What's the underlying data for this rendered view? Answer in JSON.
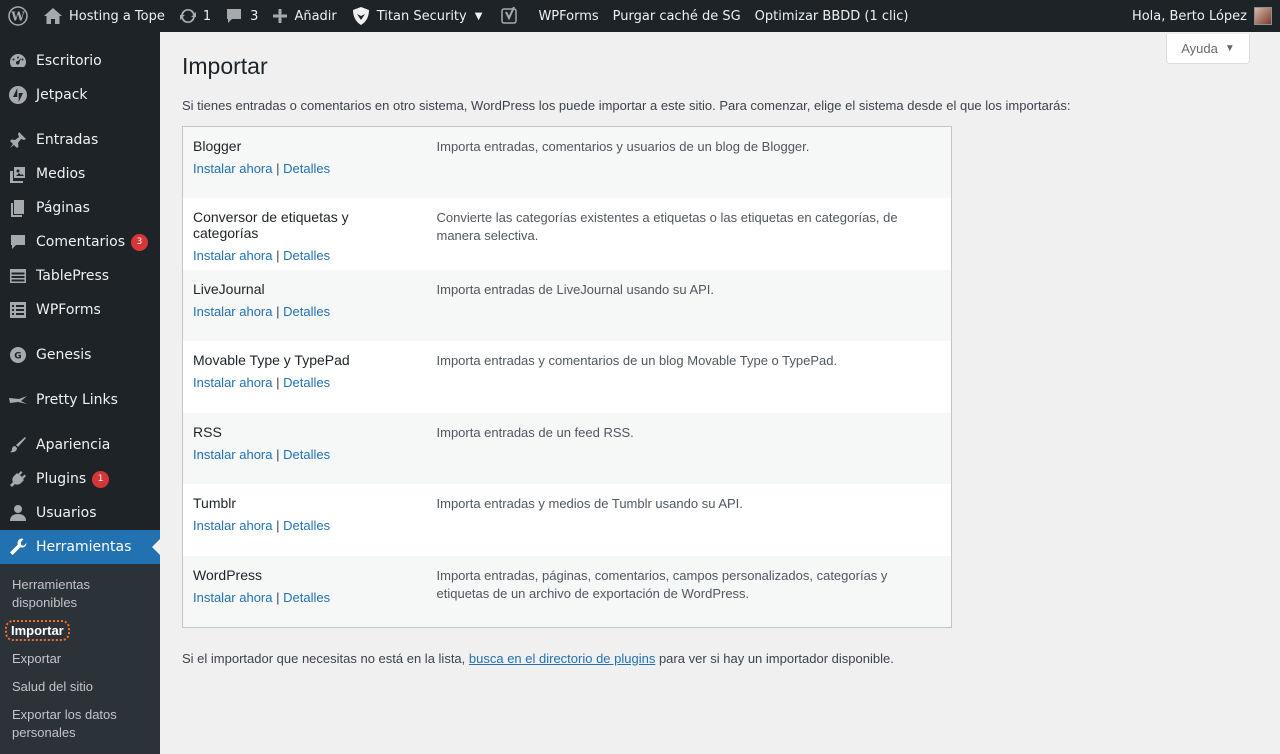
{
  "adminbar": {
    "site_name": "Hosting a Tope",
    "updates_count": "1",
    "comments_count": "3",
    "add_label": "Añadir",
    "titan_label": "Titan Security",
    "wpforms_label": "WPForms",
    "purge_label": "Purgar caché de SG",
    "optimize_label": "Optimizar BBDD (1 clic)",
    "greeting": "Hola, Berto López"
  },
  "sidebar": {
    "items": [
      {
        "label": "Escritorio",
        "icon": "dashboard-icon"
      },
      {
        "label": "Jetpack",
        "icon": "jetpack-icon"
      },
      {
        "label": "Entradas",
        "icon": "pin-icon"
      },
      {
        "label": "Medios",
        "icon": "media-icon"
      },
      {
        "label": "Páginas",
        "icon": "pages-icon"
      },
      {
        "label": "Comentarios",
        "icon": "comments-icon",
        "badge": "3"
      },
      {
        "label": "TablePress",
        "icon": "table-icon"
      },
      {
        "label": "WPForms",
        "icon": "forms-icon"
      },
      {
        "label": "Genesis",
        "icon": "genesis-icon"
      },
      {
        "label": "Pretty Links",
        "icon": "prettylinks-icon"
      },
      {
        "label": "Apariencia",
        "icon": "brush-icon"
      },
      {
        "label": "Plugins",
        "icon": "plugin-icon",
        "badge": "1"
      },
      {
        "label": "Usuarios",
        "icon": "users-icon"
      },
      {
        "label": "Herramientas",
        "icon": "wrench-icon"
      }
    ],
    "submenu": [
      "Herramientas disponibles",
      "Importar",
      "Exportar",
      "Salud del sitio",
      "Exportar los datos personales"
    ]
  },
  "main": {
    "help_label": "Ayuda",
    "title": "Importar",
    "intro": "Si tienes entradas o comentarios en otro sistema, WordPress los puede importar a este sitio. Para comenzar, elige el sistema desde el que los importarás:",
    "install_label": "Instalar ahora",
    "details_label": "Detalles",
    "importers": [
      {
        "name": "Blogger",
        "desc": "Importa entradas, comentarios y usuarios de un blog de Blogger."
      },
      {
        "name": "Conversor de etiquetas y categorías",
        "desc": "Convierte las categorías existentes a etiquetas o las etiquetas en categorías, de manera selectiva."
      },
      {
        "name": "LiveJournal",
        "desc": "Importa entradas de LiveJournal usando su API."
      },
      {
        "name": "Movable Type y TypePad",
        "desc": "Importa entradas y comentarios de un blog Movable Type o TypePad."
      },
      {
        "name": "RSS",
        "desc": "Importa entradas de un feed RSS."
      },
      {
        "name": "Tumblr",
        "desc": "Importa entradas y medios de Tumblr usando su API."
      },
      {
        "name": "WordPress",
        "desc": "Importa entradas, páginas, comentarios, campos personalizados, categorías y etiquetas de un archivo de exportación de WordPress."
      }
    ],
    "footer_pre": "Si el importador que necesitas no está en la lista, ",
    "footer_link": "busca en el directorio de plugins",
    "footer_post": " para ver si hay un importador disponible."
  }
}
